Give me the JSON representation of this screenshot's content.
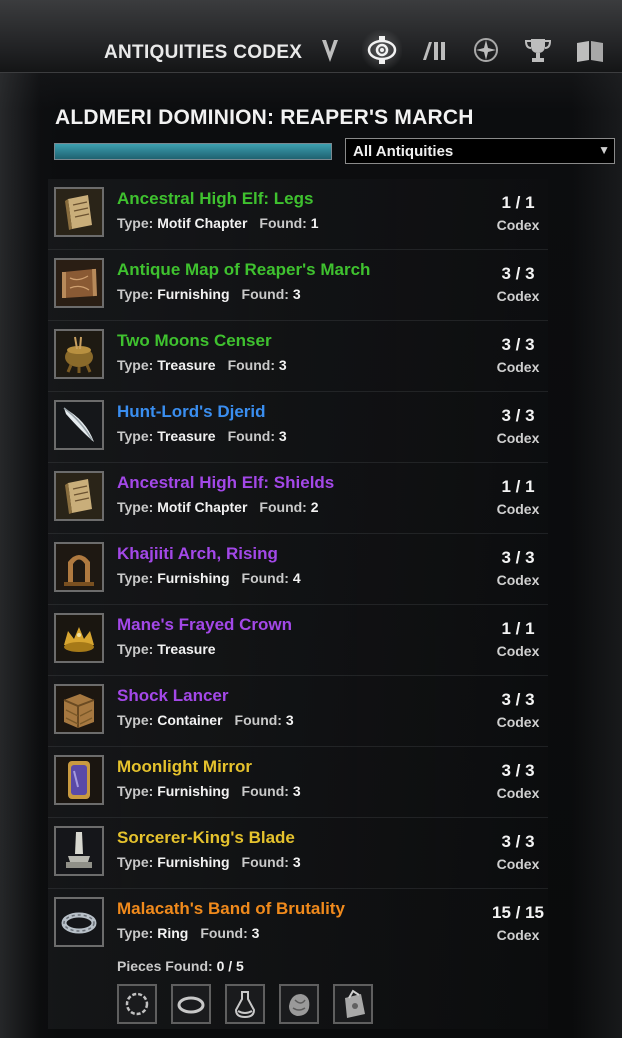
{
  "header": {
    "title": "ANTIQUITIES CODEX",
    "tabs": [
      {
        "name": "v-emblem-icon",
        "active": false
      },
      {
        "name": "scrying-eye-icon",
        "active": true
      },
      {
        "name": "bars-icon",
        "active": false
      },
      {
        "name": "compass-icon",
        "active": false
      },
      {
        "name": "trophy-icon",
        "active": false
      },
      {
        "name": "book-icon",
        "active": false
      }
    ]
  },
  "zone": {
    "title": "ALDMERI DOMINION: REAPER'S MARCH",
    "progress_fraction": 1.0
  },
  "filter": {
    "selected": "All Antiquities"
  },
  "labels": {
    "type": "Type:",
    "found": "Found:",
    "codex": "Codex",
    "pieces_found": "Pieces Found:"
  },
  "items": [
    {
      "name": "Ancestral High Elf: Legs",
      "color": "#3fc12f",
      "type": "Motif Chapter",
      "found": "1",
      "count": "1 / 1",
      "icon": "scroll-icon"
    },
    {
      "name": "Antique Map of Reaper's March",
      "color": "#3fc12f",
      "type": "Furnishing",
      "found": "3",
      "count": "3 / 3",
      "icon": "map-icon"
    },
    {
      "name": "Two Moons Censer",
      "color": "#3fc12f",
      "type": "Treasure",
      "found": "3",
      "count": "3 / 3",
      "icon": "censer-icon"
    },
    {
      "name": "Hunt-Lord's Djerid",
      "color": "#3a8ef0",
      "type": "Treasure",
      "found": "3",
      "count": "3 / 3",
      "icon": "blade-icon"
    },
    {
      "name": "Ancestral High Elf: Shields",
      "color": "#a348e8",
      "type": "Motif Chapter",
      "found": "2",
      "count": "1 / 1",
      "icon": "scroll-icon"
    },
    {
      "name": "Khajiiti Arch, Rising",
      "color": "#a348e8",
      "type": "Furnishing",
      "found": "4",
      "count": "3 / 3",
      "icon": "arch-icon"
    },
    {
      "name": "Mane's Frayed Crown",
      "color": "#a348e8",
      "type": "Treasure",
      "found": "",
      "count": "1 / 1",
      "icon": "crown-icon"
    },
    {
      "name": "Shock Lancer",
      "color": "#a348e8",
      "type": "Container",
      "found": "3",
      "count": "3 / 3",
      "icon": "crate-icon"
    },
    {
      "name": "Moonlight Mirror",
      "color": "#e5c22d",
      "type": "Furnishing",
      "found": "3",
      "count": "3 / 3",
      "icon": "mirror-icon"
    },
    {
      "name": "Sorcerer-King's Blade",
      "color": "#e5c22d",
      "type": "Furnishing",
      "found": "3",
      "count": "3 / 3",
      "icon": "statue-icon"
    }
  ],
  "mythic": {
    "name": "Malacath's Band of Brutality",
    "color": "#f08a1c",
    "type": "Ring",
    "found": "3",
    "count": "15 / 15",
    "icon": "ring-icon",
    "pieces_found": "0 / 5",
    "pieces": [
      "circlet-piece-icon",
      "band-piece-icon",
      "vial-piece-icon",
      "stone-piece-icon",
      "pouch-piece-icon"
    ]
  }
}
